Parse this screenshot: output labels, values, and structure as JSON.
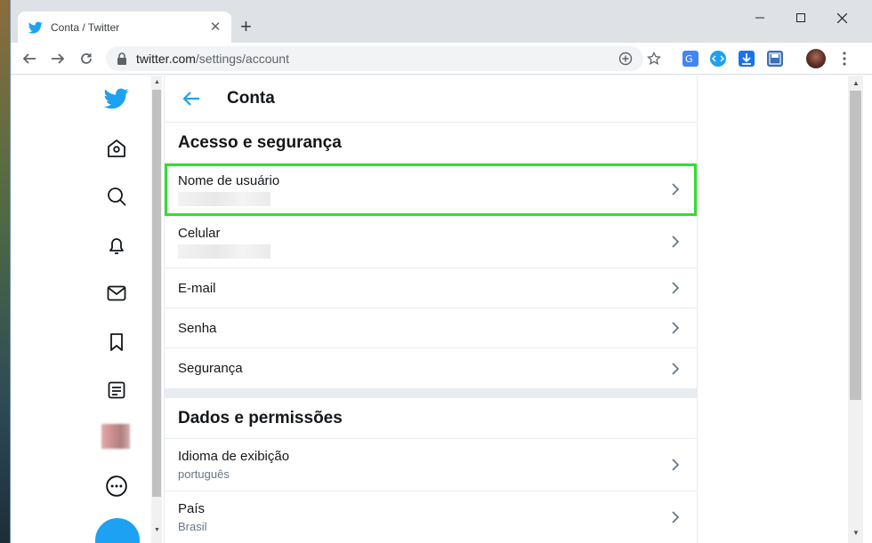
{
  "browser": {
    "tab_title": "Conta / Twitter",
    "tab_close": "✕",
    "new_tab": "+",
    "url_host": "twitter.com",
    "url_path": "/settings/account",
    "window_controls": {
      "minimize": "—",
      "maximize": "☐",
      "close": "✕"
    }
  },
  "header": {
    "title": "Conta"
  },
  "sections": {
    "access": {
      "title": "Acesso e segurança",
      "items": [
        {
          "label": "Nome de usuário"
        },
        {
          "label": "Celular"
        },
        {
          "label": "E-mail"
        },
        {
          "label": "Senha"
        },
        {
          "label": "Segurança"
        }
      ]
    },
    "data": {
      "title": "Dados e permissões",
      "items": [
        {
          "label": "Idioma de exibição",
          "value": "português"
        },
        {
          "label": "País",
          "value": "Brasil"
        }
      ]
    }
  },
  "sidebar_icons": [
    "twitter-logo-icon",
    "home-icon",
    "explore-icon",
    "notifications-icon",
    "messages-icon",
    "bookmarks-icon",
    "lists-icon",
    "profile-avatar",
    "more-icon",
    "compose-tweet-button"
  ],
  "colors": {
    "accent": "#1da1f2",
    "highlight": "#2fe02f",
    "text": "#14171a",
    "muted": "#657786"
  }
}
